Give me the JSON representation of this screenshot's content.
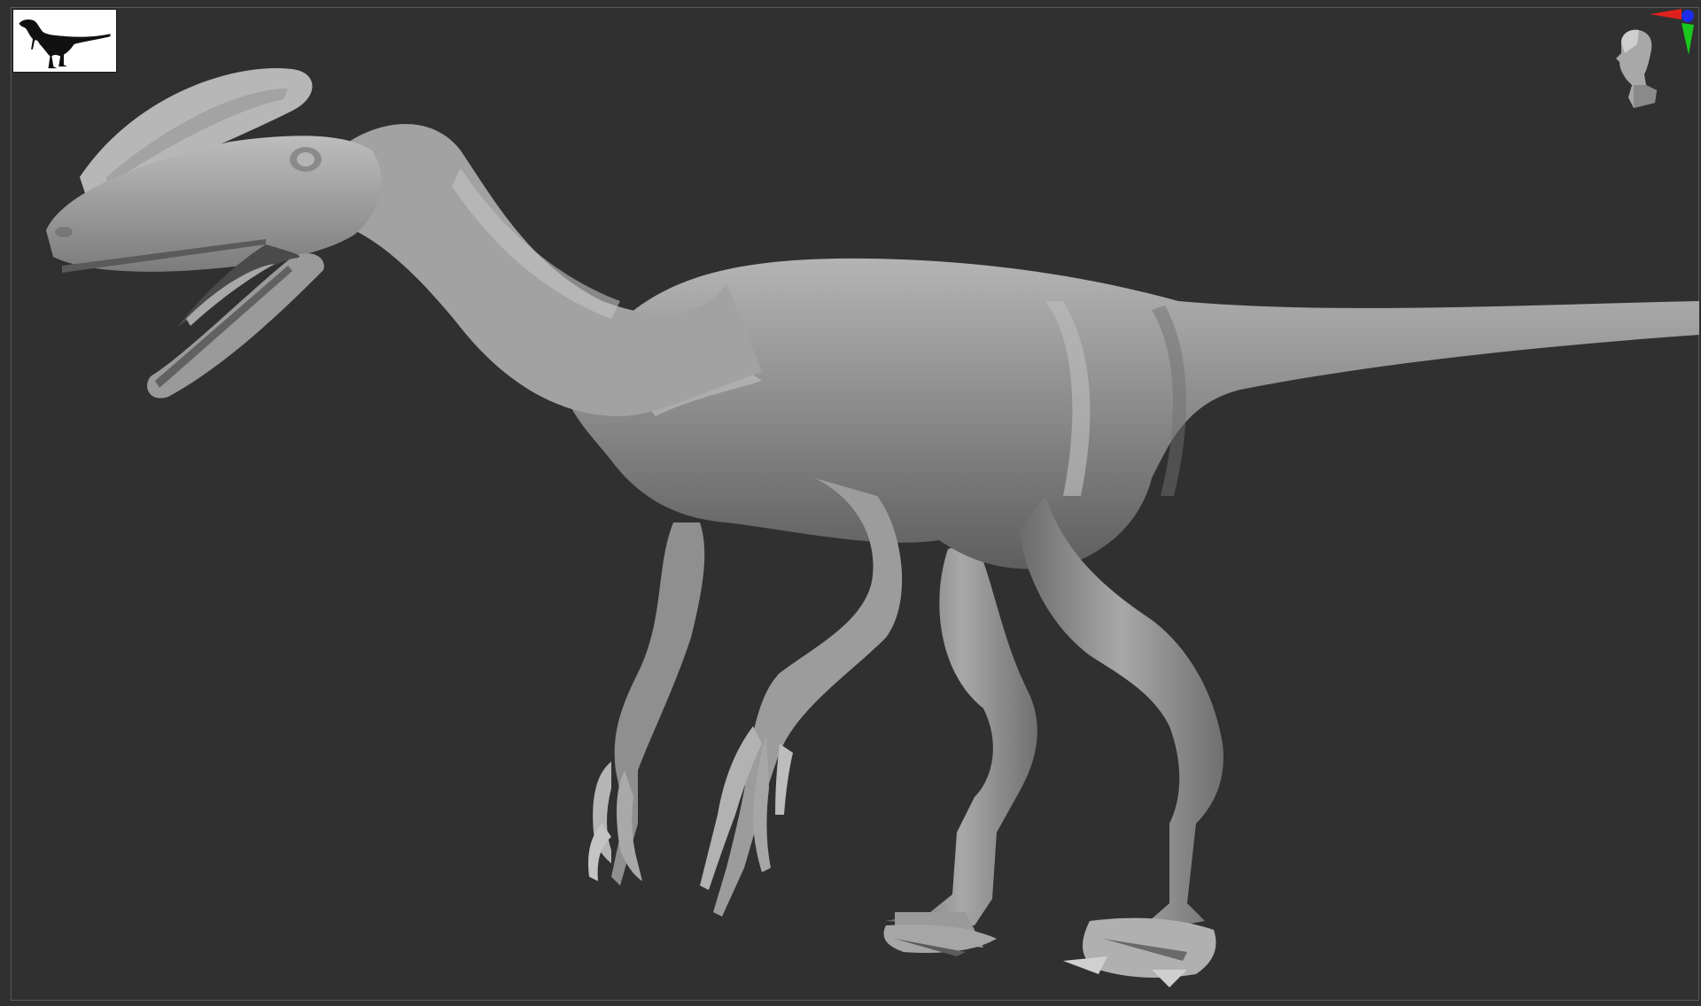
{
  "viewport": {
    "background_color": "#303030",
    "frame_color": "#5a5a5a"
  },
  "thumbnail": {
    "icon": "dinosaur-silhouette-icon",
    "background_color": "#ffffff"
  },
  "navigation_gizmo": {
    "icon": "head-orientation-gizmo-icon",
    "axes": [
      {
        "name": "x",
        "color": "#e0201c"
      },
      {
        "name": "y",
        "color": "#18c81c"
      },
      {
        "name": "z",
        "color": "#1c2ce8"
      }
    ]
  },
  "model": {
    "subject": "theropod-sculpt",
    "material_color": "#9a9a9a"
  }
}
